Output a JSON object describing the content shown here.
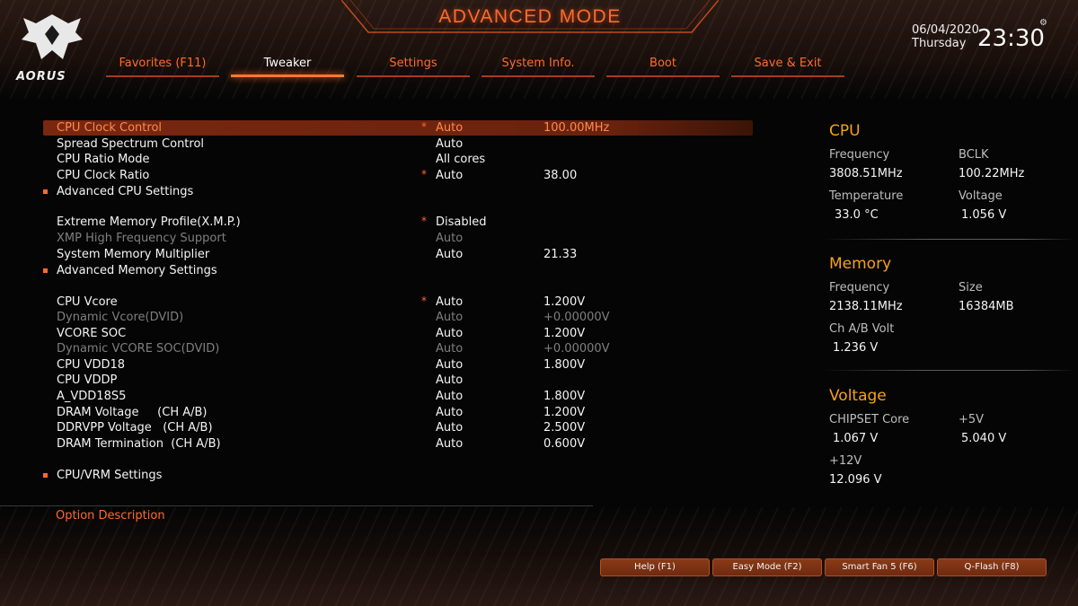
{
  "header": {
    "title": "ADVANCED MODE",
    "logo_text": "AORUS",
    "date": "06/04/2020",
    "weekday": "Thursday",
    "time": "23:30"
  },
  "tabs": [
    {
      "label": "Favorites (F11)"
    },
    {
      "label": "Tweaker"
    },
    {
      "label": "Settings"
    },
    {
      "label": "System Info."
    },
    {
      "label": "Boot"
    },
    {
      "label": "Save & Exit"
    }
  ],
  "menu": [
    {
      "name": "CPU Clock Control",
      "star": "*",
      "value": "Auto",
      "value2": "100.00MHz"
    },
    {
      "name": "Spread Spectrum Control",
      "star": "",
      "value": "Auto",
      "value2": ""
    },
    {
      "name": "CPU Ratio Mode",
      "star": "",
      "value": "All cores",
      "value2": ""
    },
    {
      "name": "CPU Clock Ratio",
      "star": "*",
      "value": "Auto",
      "value2": "38.00"
    },
    {
      "name": "Advanced CPU Settings",
      "star": "",
      "value": "",
      "value2": ""
    },
    {
      "name": "Extreme Memory Profile(X.M.P.)",
      "star": "*",
      "value": "Disabled",
      "value2": ""
    },
    {
      "name": "XMP High Frequency Support",
      "star": "",
      "value": "Auto",
      "value2": ""
    },
    {
      "name": "System Memory Multiplier",
      "star": "",
      "value": "Auto",
      "value2": "21.33"
    },
    {
      "name": "Advanced Memory Settings",
      "star": "",
      "value": "",
      "value2": ""
    },
    {
      "name": "CPU Vcore",
      "star": "*",
      "value": "Auto",
      "value2": "1.200V"
    },
    {
      "name": "Dynamic Vcore(DVID)",
      "star": "",
      "value": "Auto",
      "value2": "+0.00000V"
    },
    {
      "name": "VCORE SOC",
      "star": "",
      "value": "Auto",
      "value2": "1.200V"
    },
    {
      "name": "Dynamic VCORE SOC(DVID)",
      "star": "",
      "value": "Auto",
      "value2": "+0.00000V"
    },
    {
      "name": "CPU VDD18",
      "star": "",
      "value": "Auto",
      "value2": "1.800V"
    },
    {
      "name": "CPU VDDP",
      "star": "",
      "value": "Auto",
      "value2": ""
    },
    {
      "name": "A_VDD18S5",
      "star": "",
      "value": "Auto",
      "value2": "1.800V"
    },
    {
      "name": "DRAM Voltage     (CH A/B)",
      "star": "",
      "value": "Auto",
      "value2": "1.200V"
    },
    {
      "name": "DDRVPP Voltage   (CH A/B)",
      "star": "",
      "value": "Auto",
      "value2": "2.500V"
    },
    {
      "name": "DRAM Termination  (CH A/B)",
      "star": "",
      "value": "Auto",
      "value2": "0.600V"
    },
    {
      "name": "CPU/VRM Settings",
      "star": "",
      "value": "",
      "value2": ""
    }
  ],
  "option_description": "Option Description",
  "cpu": {
    "title": "CPU",
    "frequency_label": "Frequency",
    "frequency": "3808.51MHz",
    "bclk_label": "BCLK",
    "bclk": "100.22MHz",
    "temperature_label": "Temperature",
    "temperature": "33.0 °C",
    "voltage_label": "Voltage",
    "voltage": "1.056 V"
  },
  "memory": {
    "title": "Memory",
    "frequency_label": "Frequency",
    "frequency": "2138.11MHz",
    "size_label": "Size",
    "size": "16384MB",
    "volt_label": "Ch A/B Volt",
    "volt": "1.236 V"
  },
  "voltage": {
    "title": "Voltage",
    "chipset_label": "CHIPSET Core",
    "chipset": "1.067 V",
    "p5v_label": "+5V",
    "p5v": "5.040 V",
    "p12v_label": "+12V",
    "p12v": "12.096 V"
  },
  "function_buttons": [
    {
      "label": "Help (F1)"
    },
    {
      "label": "Easy Mode (F2)"
    },
    {
      "label": "Smart Fan 5 (F6)"
    },
    {
      "label": "Q-Flash (F8)"
    }
  ],
  "colors": {
    "accent": "#ff6a2a",
    "highlight": "#f5a21a",
    "selected_row": "#7a2710"
  }
}
